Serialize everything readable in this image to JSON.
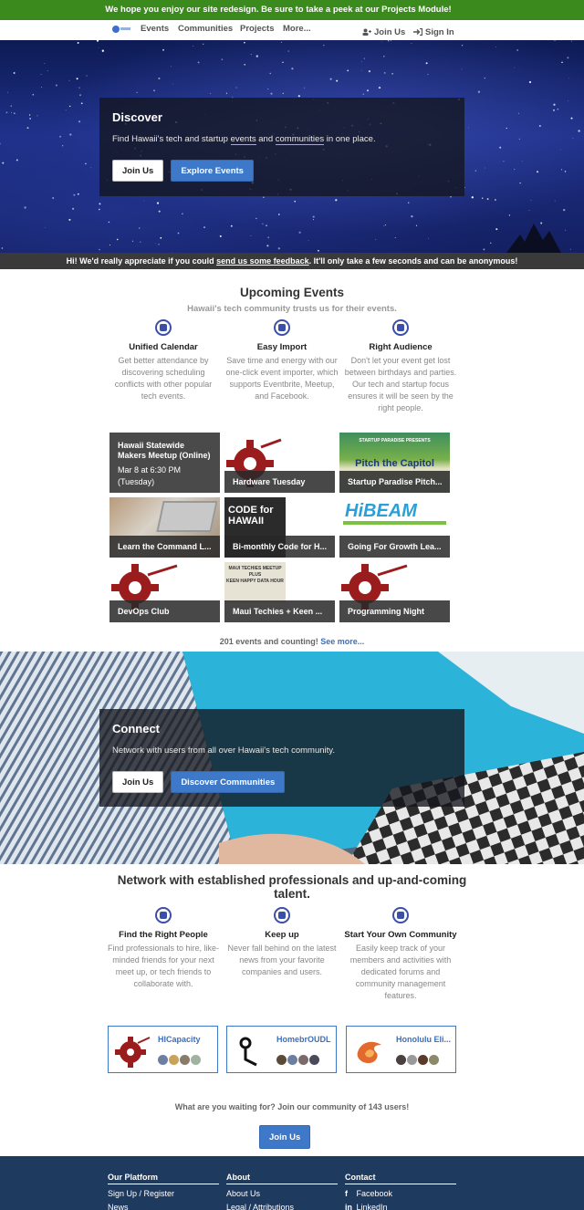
{
  "banner": {
    "text": "We hope you enjoy our site redesign. Be sure to take a peek at our Projects Module!"
  },
  "nav": {
    "items": [
      "Events",
      "Communities",
      "Projects",
      "More..."
    ],
    "join": "Join Us",
    "signin": "Sign In"
  },
  "hero": {
    "title": "Discover",
    "desc_prefix": "Find Hawaii's tech and startup ",
    "desc_link1": "events",
    "desc_mid": " and ",
    "desc_link2": "communities",
    "desc_suffix": " in one place.",
    "join_button": "Join Us",
    "explore_button": "Explore Events"
  },
  "feedback": {
    "prefix": "Hi! We'd really appreciate if you could ",
    "link": "send us some feedback",
    "suffix": ". It'll only take a few seconds and can be anonymous!"
  },
  "events_section": {
    "title": "Upcoming Events",
    "subtitle": "Hawaii's tech community trusts us for their events.",
    "features": [
      {
        "icon": "calendar-icon",
        "name": "Unified Calendar",
        "desc": "Get better attendance by discovering scheduling conflicts with other popular tech events."
      },
      {
        "icon": "import-icon",
        "name": "Easy Import",
        "desc": "Save time and energy with our one-click event importer, which supports Eventbrite, Meetup, and Facebook."
      },
      {
        "icon": "audience-icon",
        "name": "Right Audience",
        "desc": "Don't let your event get lost between birthdays and parties. Our tech and startup focus ensures it will be seen by the right people."
      }
    ],
    "events": [
      {
        "title": "Hawaii Statewide Makers Meetup (Online)",
        "date": "Mar 8 at 6:30 PM",
        "day": "(Tuesday)"
      },
      {
        "title": "Hardware Tuesday"
      },
      {
        "title": "Startup Paradise Pitch..."
      },
      {
        "title": "Learn the Command L..."
      },
      {
        "title": "Bi-monthly Code for H..."
      },
      {
        "title": "Going For Growth Lea..."
      },
      {
        "title": "DevOps Club"
      },
      {
        "title": "Maui Techies + Keen ..."
      },
      {
        "title": "Programming Night"
      }
    ],
    "counting_text": "201 events and counting!",
    "see_more": "See more..."
  },
  "tile_art": {
    "pitch_banner": "STARTUP PARADISE PRESENTS",
    "pitch_text": "Pitch the Capitol",
    "code_text_1": "CODE for",
    "code_text_2": "HAWAII",
    "hibeam": "HiBEAM",
    "maui_text_1": "MAUI TECHIES MEETUP",
    "maui_text_2": "PLUS",
    "maui_text_3": "KEEN HAPPY DATA HOUR"
  },
  "connect": {
    "title": "Connect",
    "desc": "Network with users from all over Hawaii's tech community.",
    "join_button": "Join Us",
    "discover_button": "Discover Communities"
  },
  "network_section": {
    "title_line1": "Network with established professionals and up-and-coming",
    "title_line2": "talent.",
    "features": [
      {
        "icon": "people-icon",
        "name": "Find the Right People",
        "desc": "Find professionals to hire, like-minded friends for your next meet up, or tech friends to collaborate with."
      },
      {
        "icon": "news-icon",
        "name": "Keep up",
        "desc": "Never fall behind on the latest news from your favorite companies and users."
      },
      {
        "icon": "community-icon",
        "name": "Start Your Own Community",
        "desc": "Easily keep track of your members and activities with dedicated forums and community management features."
      }
    ],
    "communities": [
      {
        "name": "HICapacity"
      },
      {
        "name": "HomebrOUDL"
      },
      {
        "name": "Honolulu Eli..."
      }
    ],
    "waiting_text": "What are you waiting for? Join our community of 143 users!",
    "join_button": "Join Us"
  },
  "footer": {
    "platform": {
      "heading": "Our Platform",
      "items": [
        "Sign Up / Register",
        "News"
      ]
    },
    "about": {
      "heading": "About",
      "items": [
        "About Us",
        "Legal / Attributions"
      ]
    },
    "contact": {
      "heading": "Contact",
      "items": [
        "Facebook",
        "LinkedIn"
      ]
    }
  },
  "colors": {
    "banner_green": "#3b8a1e",
    "accent_blue": "#3e78c8",
    "footer_navy": "#1f3a5f",
    "gear_red": "#9a1c1c"
  }
}
